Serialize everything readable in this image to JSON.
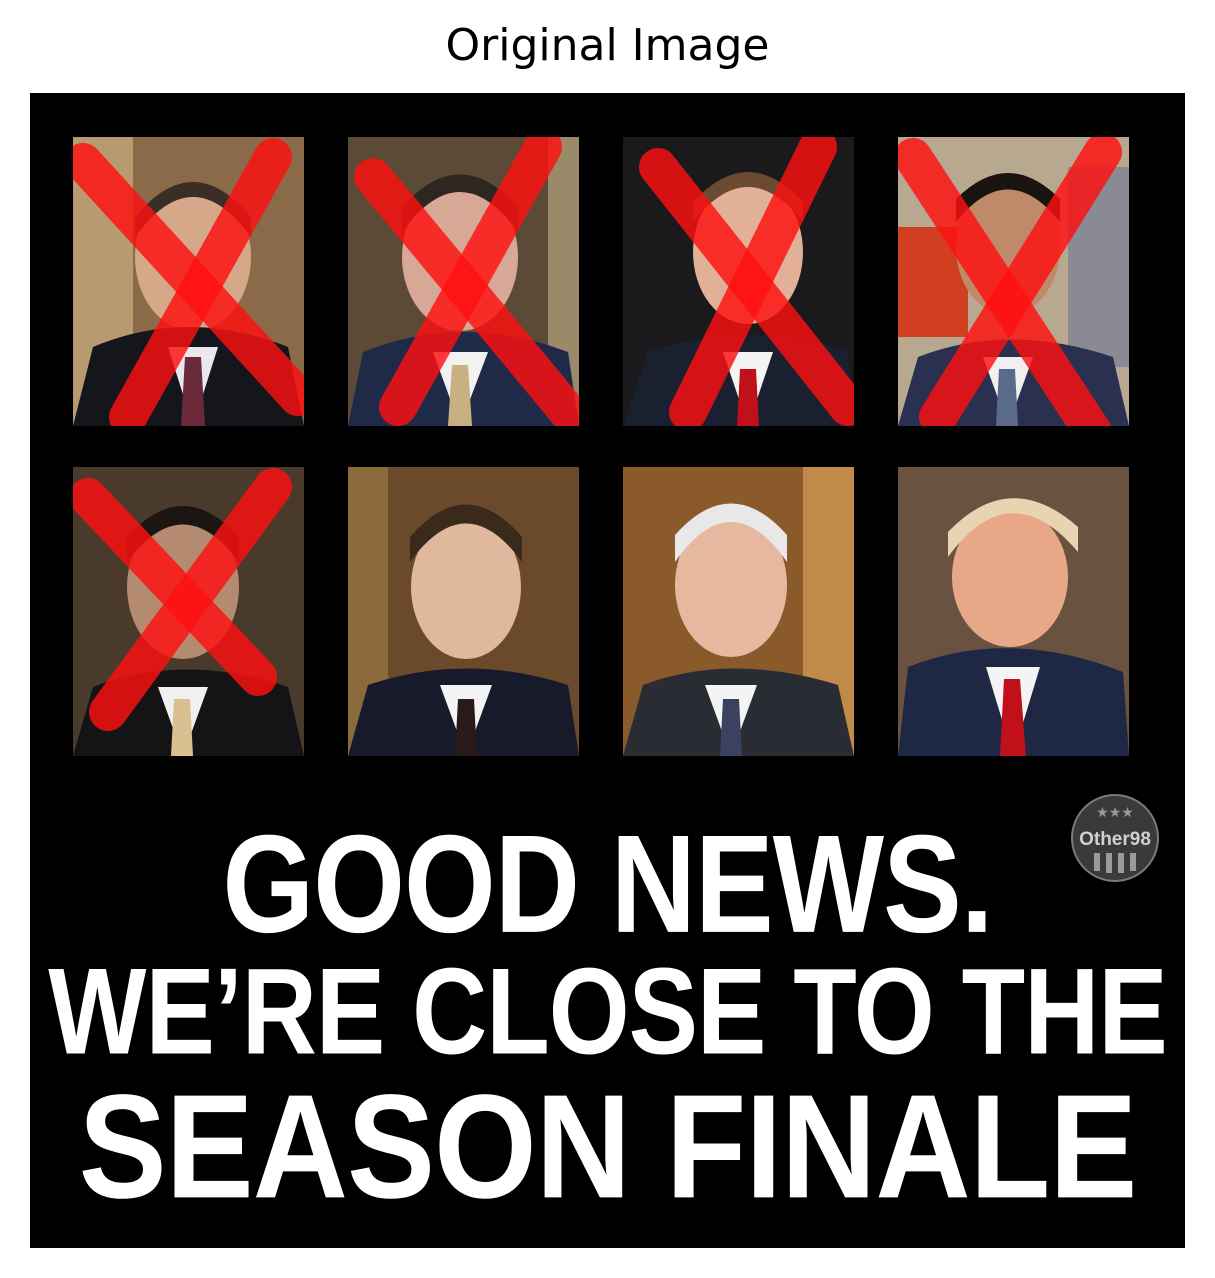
{
  "figure_title": "Original Image",
  "poster": {
    "headline": {
      "line1": "GOOD NEWS.",
      "line2": "WE’RE CLOSE TO THE",
      "line3": "SEASON FINALE"
    },
    "logo_text": "Other98",
    "cross_color": "#ff1010",
    "background_color": "#000000",
    "photos": [
      {
        "crossed": true,
        "icon": "portrait-photo-icon"
      },
      {
        "crossed": true,
        "icon": "portrait-photo-icon"
      },
      {
        "crossed": true,
        "icon": "portrait-photo-icon"
      },
      {
        "crossed": true,
        "icon": "portrait-photo-icon"
      },
      {
        "crossed": true,
        "icon": "portrait-photo-icon"
      },
      {
        "crossed": false,
        "icon": "portrait-photo-icon"
      },
      {
        "crossed": false,
        "icon": "portrait-photo-icon"
      },
      {
        "crossed": false,
        "icon": "portrait-photo-icon"
      }
    ]
  }
}
